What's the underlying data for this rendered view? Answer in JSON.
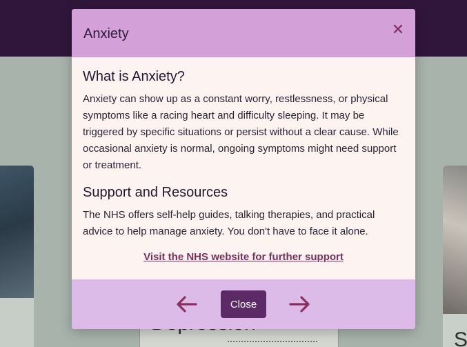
{
  "background": {
    "card_mid_title": "Depression",
    "card_right_title": "S"
  },
  "modal": {
    "title": "Anxiety",
    "close_icon": "close-icon",
    "section1": {
      "heading": "What is Anxiety?",
      "text": "Anxiety can show up as a constant worry, restlessness, or physical symptoms like a racing heart and difficulty sleeping. It may be triggered by specific situations or persist without a clear cause. While occasional anxiety is normal, ongoing symptoms might need support or treatment."
    },
    "section2": {
      "heading": "Support and Resources",
      "text": "The NHS offers self-help guides, talking therapies, and practical advice to help manage anxiety. You don't have to face it alone."
    },
    "link_text": "Visit the NHS website for further support",
    "footer": {
      "prev_icon": "arrow-left-icon",
      "next_icon": "arrow-right-icon",
      "close_label": "Close"
    }
  },
  "colors": {
    "header_bg": "#30163b",
    "modal_header": "#d3a0d8",
    "modal_body": "#fdf3f1",
    "modal_footer": "#dcbbe8",
    "accent": "#7b2f5c",
    "button": "#5c2a66"
  }
}
